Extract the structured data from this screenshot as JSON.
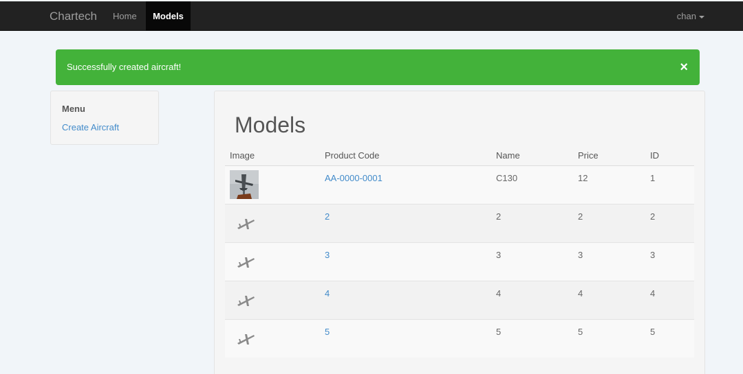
{
  "navbar": {
    "brand": "Chartech",
    "links": [
      {
        "label": "Home",
        "active": false
      },
      {
        "label": "Models",
        "active": true
      }
    ],
    "user": "chan"
  },
  "alert": {
    "message": "Successfully created aircraft!",
    "close_label": "×"
  },
  "sidebar": {
    "title": "Menu",
    "items": [
      {
        "label": "Create Aircraft"
      }
    ]
  },
  "main": {
    "title": "Models",
    "table": {
      "headers": [
        "Image",
        "Product Code",
        "Name",
        "Price",
        "ID"
      ],
      "rows": [
        {
          "image": "aircraft-photo",
          "product_code": "AA-0000-0001",
          "name": "C130",
          "price": "12",
          "id": "1"
        },
        {
          "image": "plane-icon",
          "product_code": "2",
          "name": "2",
          "price": "2",
          "id": "2"
        },
        {
          "image": "plane-icon",
          "product_code": "3",
          "name": "3",
          "price": "3",
          "id": "3"
        },
        {
          "image": "plane-icon",
          "product_code": "4",
          "name": "4",
          "price": "4",
          "id": "4"
        },
        {
          "image": "plane-icon",
          "product_code": "5",
          "name": "5",
          "price": "5",
          "id": "5"
        }
      ]
    }
  },
  "colors": {
    "navbar_bg": "#222222",
    "alert_success": "#43b23a",
    "link": "#428bca"
  }
}
